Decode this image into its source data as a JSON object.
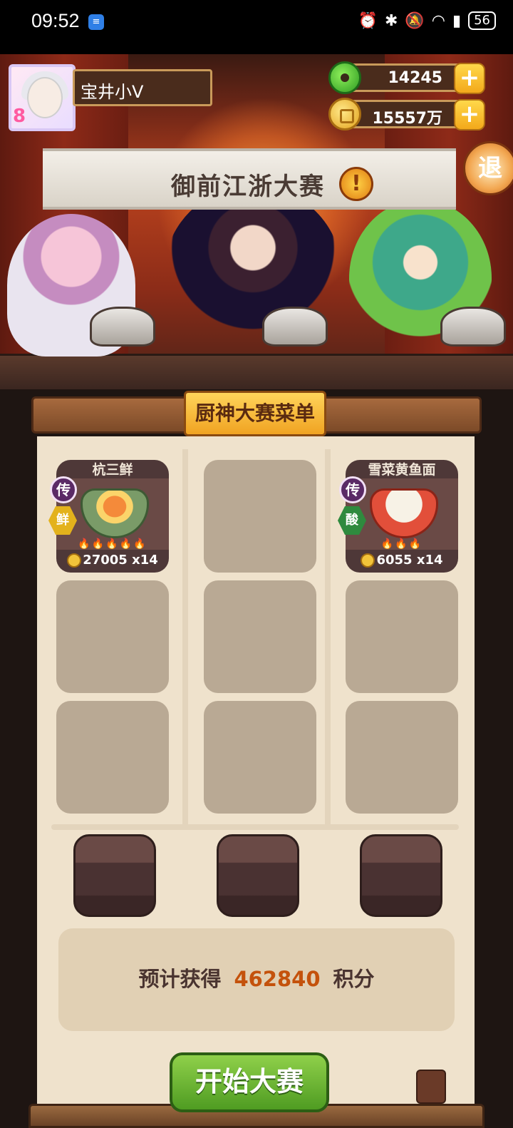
{
  "status_bar": {
    "time": "09:52",
    "battery": "56"
  },
  "player": {
    "name": "宝井小V",
    "level_badge": "8"
  },
  "currencies": {
    "jade": "14245",
    "gold": "15557万"
  },
  "buttons": {
    "exit": "退",
    "add": "+",
    "start": "开始大赛"
  },
  "banner": {
    "title": "御前江浙大赛"
  },
  "menu": {
    "title": "厨神大赛菜单",
    "dishes": [
      {
        "name": "杭三鲜",
        "rarity": "传",
        "flavor": "鲜",
        "price": "27005",
        "quantity": "x14"
      },
      {
        "name": "雪菜黄鱼面",
        "rarity": "传",
        "flavor": "酸",
        "price": "6055",
        "quantity": "x14"
      }
    ]
  },
  "score": {
    "prefix": "预计获得",
    "value": "462840",
    "suffix": "积分"
  }
}
